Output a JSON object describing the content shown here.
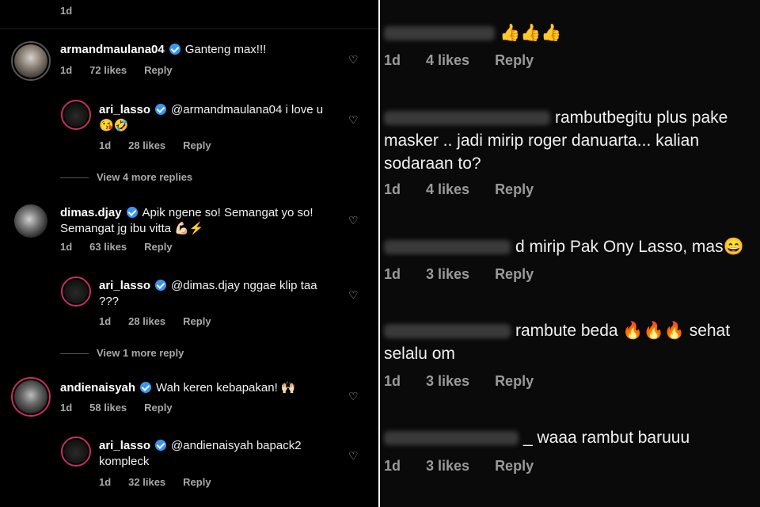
{
  "left": {
    "top_time": "1d",
    "comments": [
      {
        "username": "armandmaulana04",
        "text": "Ganteng max!!!",
        "time": "1d",
        "likes": "72 likes",
        "reply": "Reply"
      },
      {
        "username": "ari_lasso",
        "text": "@armandmaulana04 i love u 😘🤣",
        "time": "1d",
        "likes": "28 likes",
        "reply": "Reply"
      },
      {
        "username": "dimas.djay",
        "text": "Apik ngene so! Semangat yo so! Semangat jg ibu vitta 💪🏻⚡",
        "time": "1d",
        "likes": "63 likes",
        "reply": "Reply"
      },
      {
        "username": "ari_lasso",
        "text": "@dimas.djay nggae klip taa ???",
        "time": "1d",
        "likes": "28 likes",
        "reply": "Reply"
      },
      {
        "username": "andienaisyah",
        "text": "Wah keren kebapakan! 🙌🏻",
        "time": "1d",
        "likes": "58 likes",
        "reply": "Reply"
      },
      {
        "username": "ari_lasso",
        "text": "@andienaisyah bapack2 kompleck",
        "time": "1d",
        "likes": "32 likes",
        "reply": "Reply"
      }
    ],
    "view_more_1": "View 4 more replies",
    "view_more_2": "View 1 more reply"
  },
  "right": {
    "comments": [
      {
        "text": "👍👍👍",
        "time": "1d",
        "likes": "4 likes",
        "reply": "Reply"
      },
      {
        "text": "rambutbegitu plus pake masker .. jadi mirip roger danuarta... kalian sodaraan to?",
        "time": "1d",
        "likes": "4 likes",
        "reply": "Reply"
      },
      {
        "text": "d mirip Pak Ony Lasso, mas😄",
        "time": "1d",
        "likes": "3 likes",
        "reply": "Reply"
      },
      {
        "text": "rambute beda 🔥🔥🔥 sehat selalu om",
        "time": "1d",
        "likes": "3 likes",
        "reply": "Reply"
      },
      {
        "text": "_ waaa rambut baruuu",
        "time": "1d",
        "likes": "3 likes",
        "reply": "Reply"
      }
    ]
  },
  "colors": {
    "story_ring": "#c7305c",
    "verified": "#3897f0",
    "meta_gray": "#a8a8a8"
  }
}
